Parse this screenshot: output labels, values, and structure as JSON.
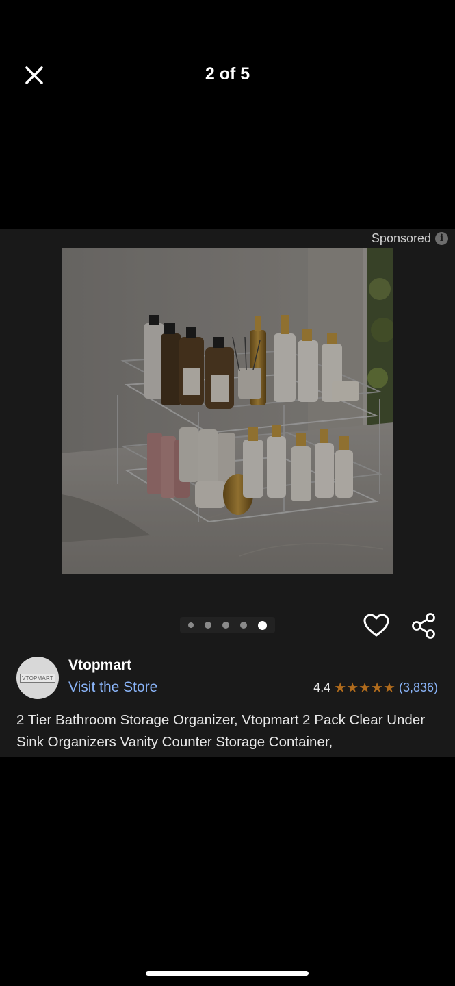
{
  "header": {
    "close_icon": "close-icon",
    "counter": "2 of 5"
  },
  "sponsored": {
    "label": "Sponsored",
    "info_icon": "i"
  },
  "gallery": {
    "total_images": 5,
    "current_index": 5
  },
  "actions": {
    "wishlist_icon": "heart-icon",
    "share_icon": "share-icon"
  },
  "brand": {
    "logo_text": "VTOPMART",
    "name": "Vtopmart",
    "store_link": "Visit the Store"
  },
  "rating": {
    "value": "4.4",
    "stars": 4.4,
    "count": "(3,836)",
    "star_color": "#b06b1c"
  },
  "product": {
    "title": "2 Tier Bathroom Storage Organizer, Vtopmart 2 Pack Clear Under Sink Organizers Vanity Counter Storage Container,"
  },
  "colors": {
    "link": "#8ab4f8",
    "panel": "#191919"
  }
}
